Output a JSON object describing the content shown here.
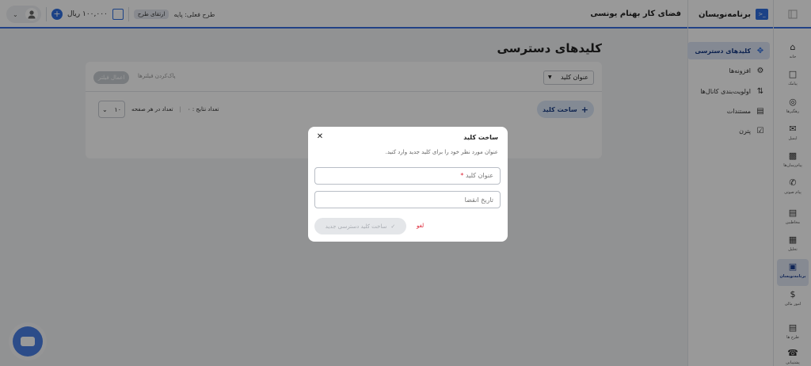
{
  "topbar": {
    "balance": "۱۰۰,۰۰۰ ریال",
    "plan_label": "طرح فعلی:",
    "plan_name": "پایه",
    "upgrade_badge": "ارتقای طرح",
    "workspace_title": "فضای کار بهنام یونسی",
    "brand_label": "برنامه‌نویسان"
  },
  "rail": {
    "items": [
      {
        "label": "خانه",
        "icon": "home-icon"
      },
      {
        "label": "پیامک",
        "icon": "sms-icon"
      },
      {
        "label": "رهگیرها",
        "icon": "tracker-icon"
      },
      {
        "label": "ایمیل",
        "icon": "mail-icon"
      },
      {
        "label": "پیام‌رسان‌ها",
        "icon": "messenger-icon"
      },
      {
        "label": "پیام صوتی",
        "icon": "phone-icon"
      },
      {
        "label": "مخاطبین",
        "icon": "contacts-icon"
      },
      {
        "label": "تحلیل",
        "icon": "analytics-icon"
      },
      {
        "label": "برنامه‌نویسان",
        "icon": "developer-icon"
      },
      {
        "label": "امور مالی",
        "icon": "dollar-icon"
      },
      {
        "label": "طرح ها",
        "icon": "plans-icon"
      },
      {
        "label": "پشتیبانی",
        "icon": "support-icon"
      }
    ]
  },
  "subnav": {
    "items": [
      {
        "label": "کلیدهای دسترسی",
        "icon": "move-icon"
      },
      {
        "label": "افزونه‌ها",
        "icon": "puzzle-icon"
      },
      {
        "label": "اولویت‌بندی کانال‌ها",
        "icon": "sort-icon"
      },
      {
        "label": "مستندات",
        "icon": "docs-icon"
      },
      {
        "label": "پترن",
        "icon": "pattern-icon"
      }
    ]
  },
  "main": {
    "page_title": "کلیدهای دسترسی",
    "apply_filter": "اعمال فیلتر",
    "clear_filter": "پاک‌کردن فیلترها",
    "key_title_select": "عنوان کلید",
    "create_key": "ساخت کلید",
    "page_size_label": "تعداد در هر صفحه",
    "page_size_value": "۱۰",
    "results_count": "تعداد نتایج : ۰"
  },
  "modal": {
    "title": "ساخت کلید",
    "description": "عنوان مورد نظر خود را برای کلید جدید وارد کنید.",
    "key_title_label": "عنوان کلید",
    "required_mark": "*",
    "expiry_placeholder": "تاریخ انقضا",
    "cancel": "لغو",
    "submit": "ساخت کلید دسترسی جدید"
  },
  "colors": {
    "accent": "#2f6fe0",
    "active_nav_bg": "#dde5f5",
    "cancel": "#dd2233"
  }
}
